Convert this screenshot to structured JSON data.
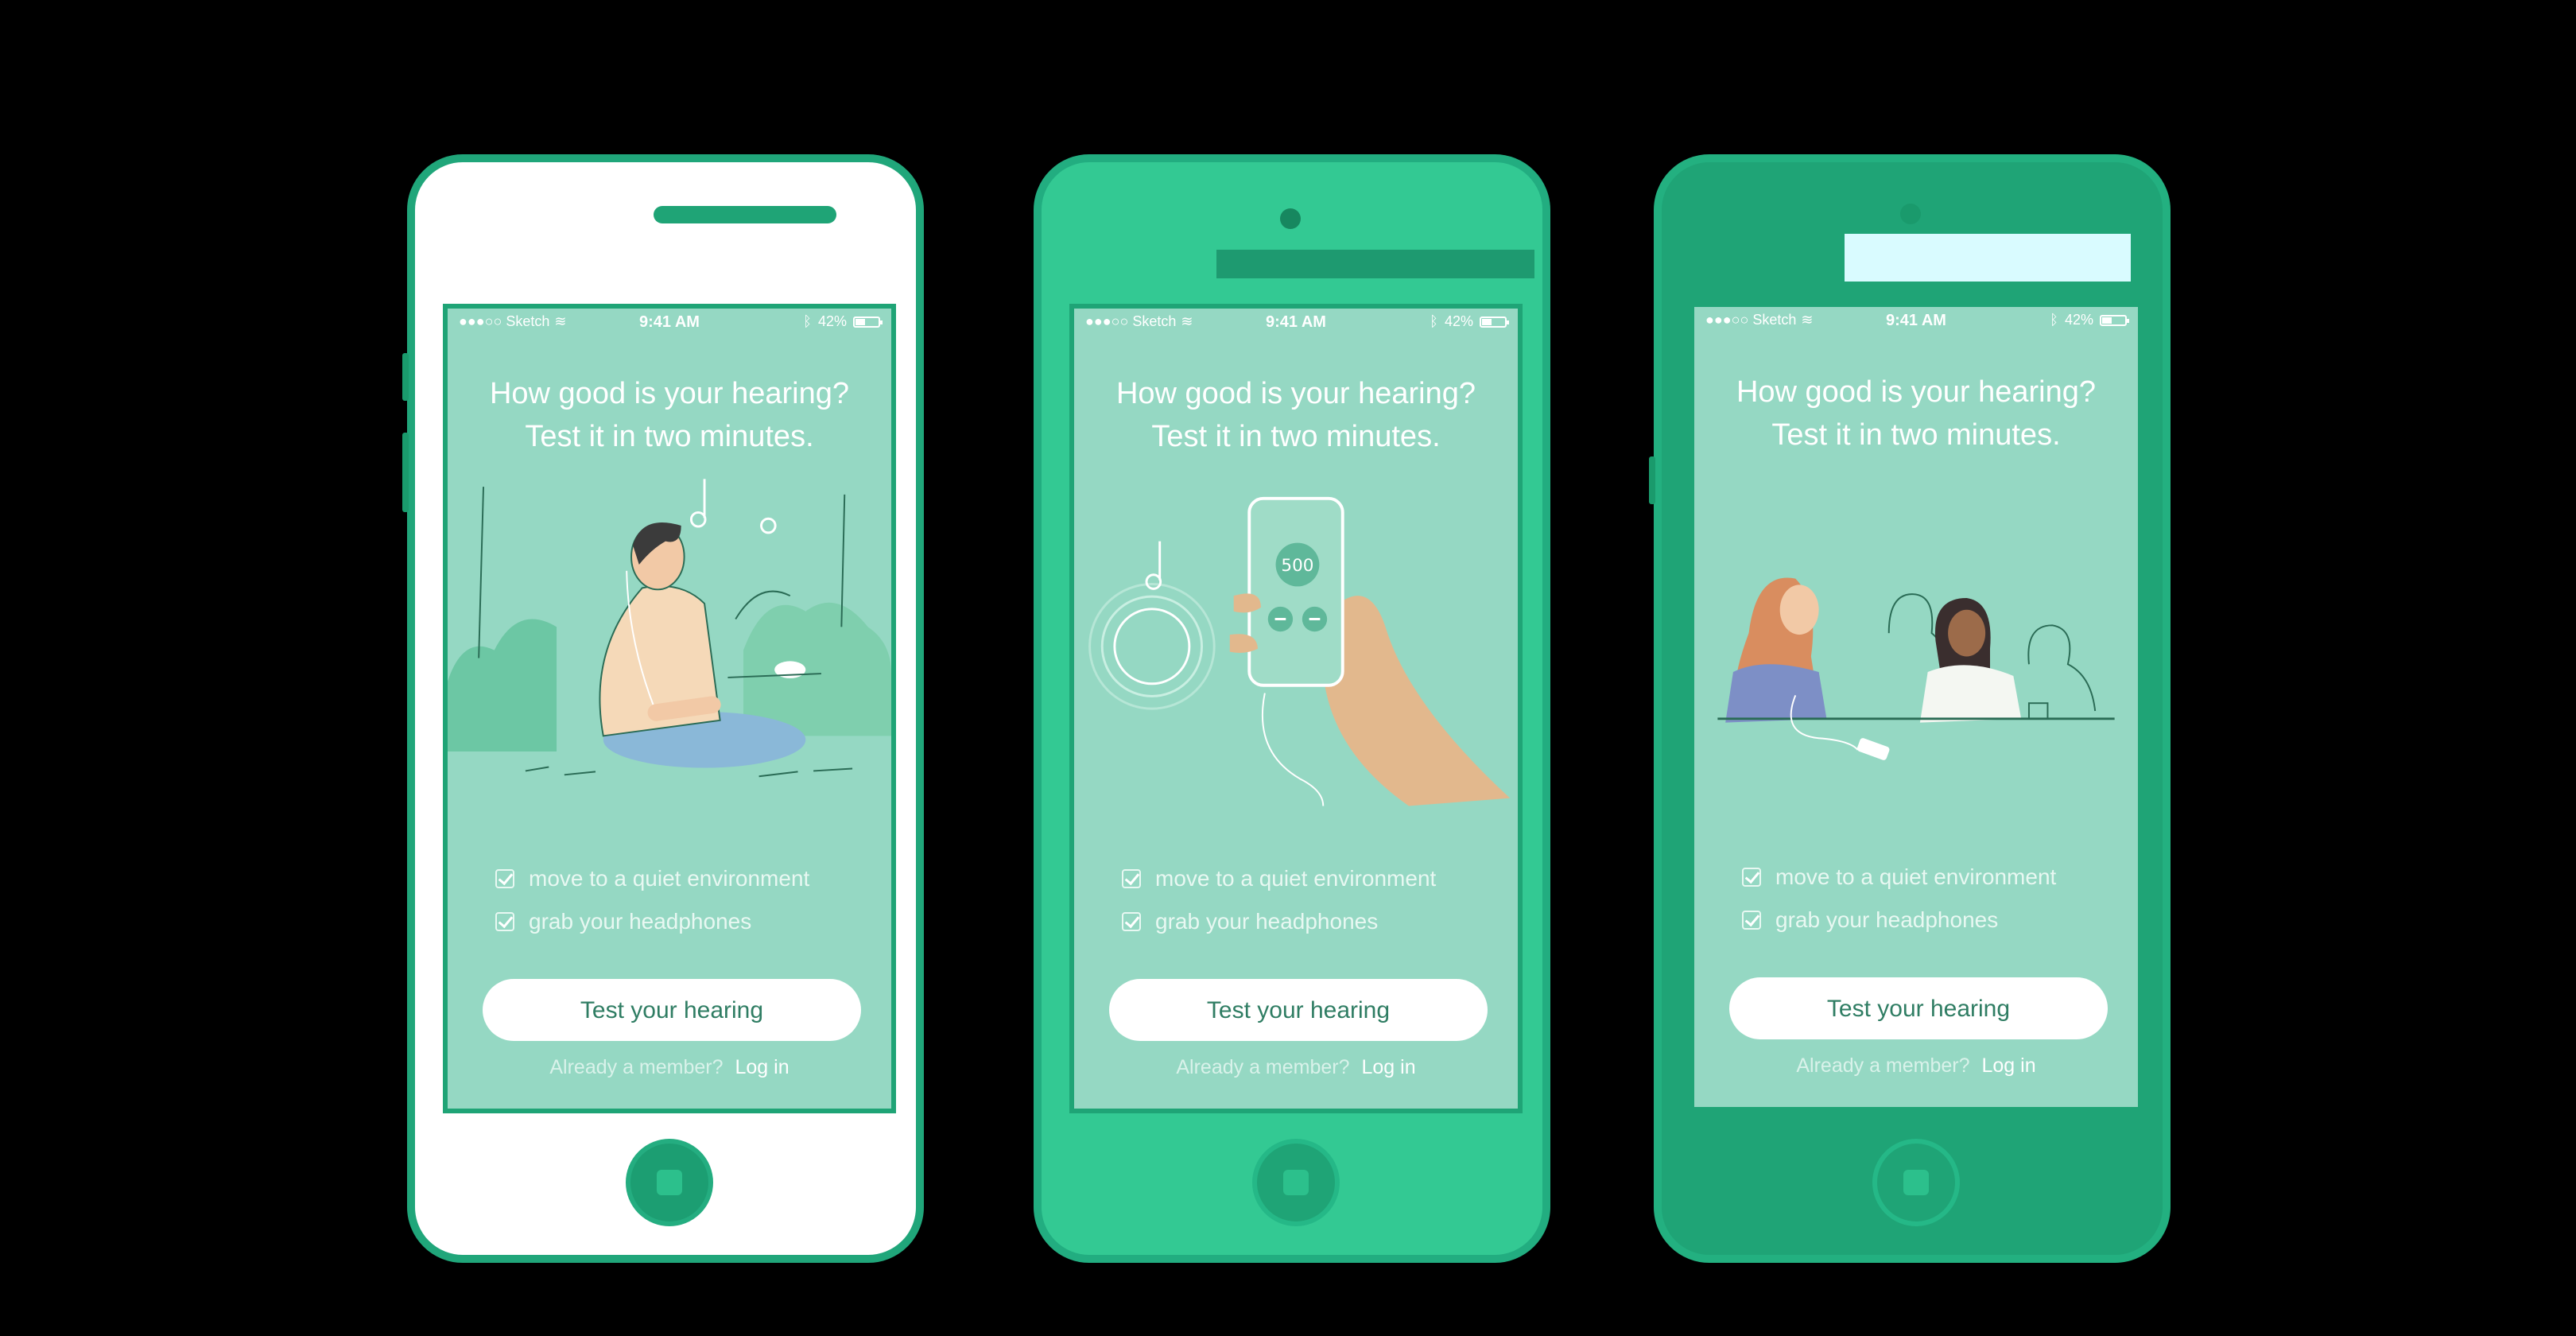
{
  "screen": {
    "status": {
      "carrier": "●●●○○ Sketch",
      "time": "9:41 AM",
      "battery": "42%"
    },
    "headline_line1": "How good is your hearing?",
    "headline_line2": "Test it in two minutes.",
    "checklist": [
      "move to a quiet environment",
      "grab your headphones"
    ],
    "cta_label": "Test your hearing",
    "login_prompt": "Already a member?",
    "login_link": "Log in",
    "illustration_text": "500"
  },
  "colors": {
    "background": "#000000",
    "screen_bg": "#95d8c3",
    "phone_green": "#1fa476",
    "phone_light": "#33c993",
    "button_text": "#2f7d63"
  },
  "phones": [
    {
      "illustration": "man-sitting-listening"
    },
    {
      "illustration": "hand-holding-phone"
    },
    {
      "illustration": "two-women-chatting"
    }
  ]
}
